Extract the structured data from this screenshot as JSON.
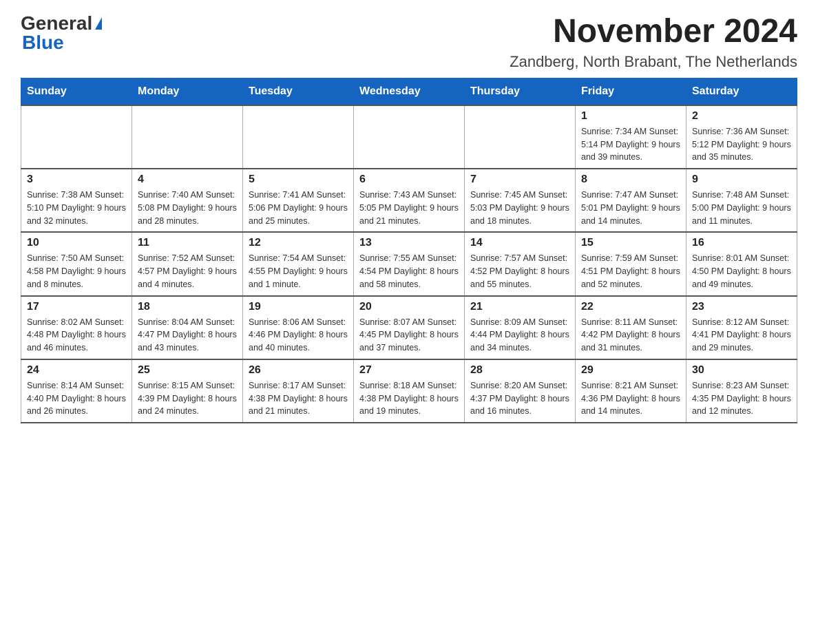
{
  "logo": {
    "general": "General",
    "blue": "Blue"
  },
  "title": "November 2024",
  "location": "Zandberg, North Brabant, The Netherlands",
  "days_of_week": [
    "Sunday",
    "Monday",
    "Tuesday",
    "Wednesday",
    "Thursday",
    "Friday",
    "Saturday"
  ],
  "weeks": [
    [
      {
        "day": "",
        "info": ""
      },
      {
        "day": "",
        "info": ""
      },
      {
        "day": "",
        "info": ""
      },
      {
        "day": "",
        "info": ""
      },
      {
        "day": "",
        "info": ""
      },
      {
        "day": "1",
        "info": "Sunrise: 7:34 AM\nSunset: 5:14 PM\nDaylight: 9 hours and 39 minutes."
      },
      {
        "day": "2",
        "info": "Sunrise: 7:36 AM\nSunset: 5:12 PM\nDaylight: 9 hours and 35 minutes."
      }
    ],
    [
      {
        "day": "3",
        "info": "Sunrise: 7:38 AM\nSunset: 5:10 PM\nDaylight: 9 hours and 32 minutes."
      },
      {
        "day": "4",
        "info": "Sunrise: 7:40 AM\nSunset: 5:08 PM\nDaylight: 9 hours and 28 minutes."
      },
      {
        "day": "5",
        "info": "Sunrise: 7:41 AM\nSunset: 5:06 PM\nDaylight: 9 hours and 25 minutes."
      },
      {
        "day": "6",
        "info": "Sunrise: 7:43 AM\nSunset: 5:05 PM\nDaylight: 9 hours and 21 minutes."
      },
      {
        "day": "7",
        "info": "Sunrise: 7:45 AM\nSunset: 5:03 PM\nDaylight: 9 hours and 18 minutes."
      },
      {
        "day": "8",
        "info": "Sunrise: 7:47 AM\nSunset: 5:01 PM\nDaylight: 9 hours and 14 minutes."
      },
      {
        "day": "9",
        "info": "Sunrise: 7:48 AM\nSunset: 5:00 PM\nDaylight: 9 hours and 11 minutes."
      }
    ],
    [
      {
        "day": "10",
        "info": "Sunrise: 7:50 AM\nSunset: 4:58 PM\nDaylight: 9 hours and 8 minutes."
      },
      {
        "day": "11",
        "info": "Sunrise: 7:52 AM\nSunset: 4:57 PM\nDaylight: 9 hours and 4 minutes."
      },
      {
        "day": "12",
        "info": "Sunrise: 7:54 AM\nSunset: 4:55 PM\nDaylight: 9 hours and 1 minute."
      },
      {
        "day": "13",
        "info": "Sunrise: 7:55 AM\nSunset: 4:54 PM\nDaylight: 8 hours and 58 minutes."
      },
      {
        "day": "14",
        "info": "Sunrise: 7:57 AM\nSunset: 4:52 PM\nDaylight: 8 hours and 55 minutes."
      },
      {
        "day": "15",
        "info": "Sunrise: 7:59 AM\nSunset: 4:51 PM\nDaylight: 8 hours and 52 minutes."
      },
      {
        "day": "16",
        "info": "Sunrise: 8:01 AM\nSunset: 4:50 PM\nDaylight: 8 hours and 49 minutes."
      }
    ],
    [
      {
        "day": "17",
        "info": "Sunrise: 8:02 AM\nSunset: 4:48 PM\nDaylight: 8 hours and 46 minutes."
      },
      {
        "day": "18",
        "info": "Sunrise: 8:04 AM\nSunset: 4:47 PM\nDaylight: 8 hours and 43 minutes."
      },
      {
        "day": "19",
        "info": "Sunrise: 8:06 AM\nSunset: 4:46 PM\nDaylight: 8 hours and 40 minutes."
      },
      {
        "day": "20",
        "info": "Sunrise: 8:07 AM\nSunset: 4:45 PM\nDaylight: 8 hours and 37 minutes."
      },
      {
        "day": "21",
        "info": "Sunrise: 8:09 AM\nSunset: 4:44 PM\nDaylight: 8 hours and 34 minutes."
      },
      {
        "day": "22",
        "info": "Sunrise: 8:11 AM\nSunset: 4:42 PM\nDaylight: 8 hours and 31 minutes."
      },
      {
        "day": "23",
        "info": "Sunrise: 8:12 AM\nSunset: 4:41 PM\nDaylight: 8 hours and 29 minutes."
      }
    ],
    [
      {
        "day": "24",
        "info": "Sunrise: 8:14 AM\nSunset: 4:40 PM\nDaylight: 8 hours and 26 minutes."
      },
      {
        "day": "25",
        "info": "Sunrise: 8:15 AM\nSunset: 4:39 PM\nDaylight: 8 hours and 24 minutes."
      },
      {
        "day": "26",
        "info": "Sunrise: 8:17 AM\nSunset: 4:38 PM\nDaylight: 8 hours and 21 minutes."
      },
      {
        "day": "27",
        "info": "Sunrise: 8:18 AM\nSunset: 4:38 PM\nDaylight: 8 hours and 19 minutes."
      },
      {
        "day": "28",
        "info": "Sunrise: 8:20 AM\nSunset: 4:37 PM\nDaylight: 8 hours and 16 minutes."
      },
      {
        "day": "29",
        "info": "Sunrise: 8:21 AM\nSunset: 4:36 PM\nDaylight: 8 hours and 14 minutes."
      },
      {
        "day": "30",
        "info": "Sunrise: 8:23 AM\nSunset: 4:35 PM\nDaylight: 8 hours and 12 minutes."
      }
    ]
  ]
}
